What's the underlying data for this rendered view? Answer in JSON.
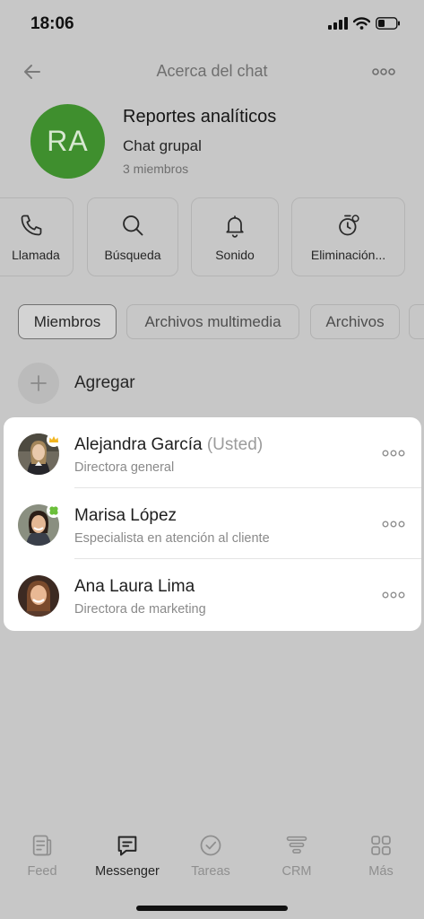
{
  "status_bar": {
    "time": "18:06"
  },
  "header": {
    "title": "Acerca del chat"
  },
  "chat": {
    "avatar_initials": "RA",
    "avatar_color": "#3f8f2e",
    "name": "Reportes analíticos",
    "type": "Chat grupal",
    "members_count": "3 miembros"
  },
  "actions": [
    {
      "label": "Llamada",
      "icon": "phone-icon"
    },
    {
      "label": "Búsqueda",
      "icon": "search-icon"
    },
    {
      "label": "Sonido",
      "icon": "bell-icon"
    },
    {
      "label": "Eliminación...",
      "icon": "timer-icon"
    }
  ],
  "tabs": [
    {
      "label": "Miembros",
      "active": true
    },
    {
      "label": "Archivos multimedia",
      "active": false
    },
    {
      "label": "Archivos",
      "active": false
    }
  ],
  "add": {
    "label": "Agregar"
  },
  "members": [
    {
      "name": "Alejandra García",
      "tag": "(Usted)",
      "role": "Directora general",
      "badge": "crown-icon"
    },
    {
      "name": "Marisa López",
      "tag": "",
      "role": "Especialista en atención al cliente",
      "badge": "clover-icon"
    },
    {
      "name": "Ana Laura Lima",
      "tag": "",
      "role": "Directora de marketing",
      "badge": ""
    }
  ],
  "bottom_nav": [
    {
      "label": "Feed",
      "icon": "feed-icon",
      "active": false
    },
    {
      "label": "Messenger",
      "icon": "chat-icon",
      "active": true
    },
    {
      "label": "Tareas",
      "icon": "check-circle-icon",
      "active": false
    },
    {
      "label": "CRM",
      "icon": "funnel-icon",
      "active": false
    },
    {
      "label": "Más",
      "icon": "grid-icon",
      "active": false
    }
  ]
}
